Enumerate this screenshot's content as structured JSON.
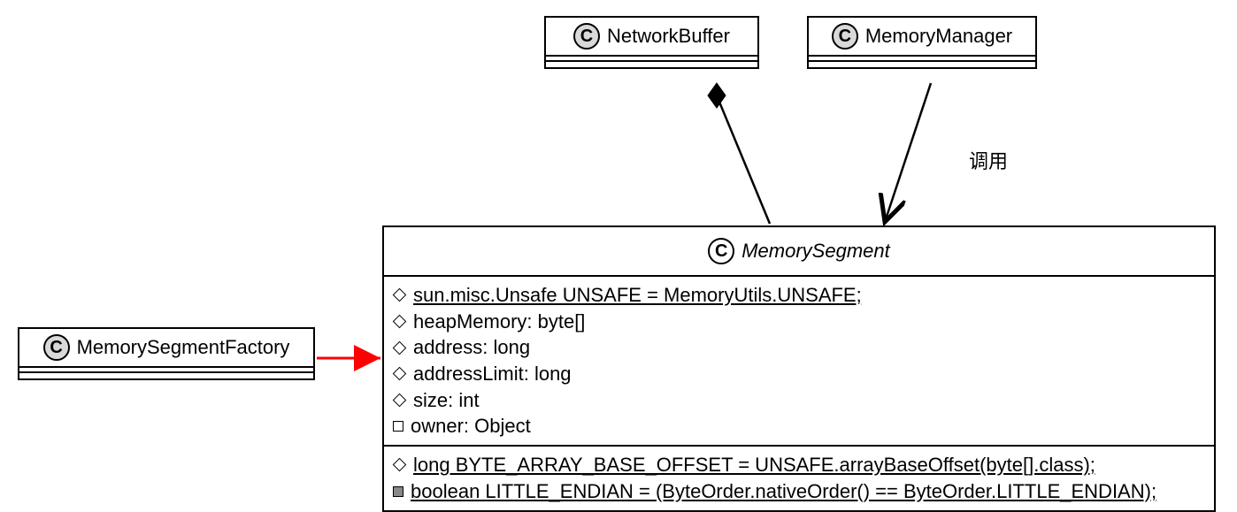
{
  "classes": {
    "networkBuffer": {
      "name": "NetworkBuffer",
      "stereotype_letter": "C"
    },
    "memoryManager": {
      "name": "MemoryManager",
      "stereotype_letter": "C"
    },
    "memorySegmentFactory": {
      "name": "MemorySegmentFactory",
      "stereotype_letter": "C"
    },
    "memorySegment": {
      "name": "MemorySegment",
      "stereotype_letter": "C",
      "attributes": [
        {
          "visibility": "diamond",
          "text": "sun.misc.Unsafe UNSAFE = MemoryUtils.UNSAFE;",
          "underline": true
        },
        {
          "visibility": "diamond",
          "text": "heapMemory: byte[]",
          "underline": false
        },
        {
          "visibility": "diamond",
          "text": "address: long",
          "underline": false
        },
        {
          "visibility": "diamond",
          "text": "addressLimit: long",
          "underline": false
        },
        {
          "visibility": "diamond",
          "text": "size: int",
          "underline": false
        },
        {
          "visibility": "square-open",
          "text": "owner: Object",
          "underline": false
        }
      ],
      "operations": [
        {
          "visibility": "diamond",
          "text": "long BYTE_ARRAY_BASE_OFFSET = UNSAFE.arrayBaseOffset(byte[].class);",
          "underline": true
        },
        {
          "visibility": "square-filled",
          "text": "boolean LITTLE_ENDIAN = (ByteOrder.nativeOrder() == ByteOrder.LITTLE_ENDIAN);",
          "underline": true
        }
      ]
    }
  },
  "relationships": {
    "factoryToSegment": {
      "type": "dependency",
      "color": "#ff0000"
    },
    "bufferToSegment": {
      "type": "composition"
    },
    "managerToSegment": {
      "type": "dependency",
      "label": "调用"
    }
  }
}
